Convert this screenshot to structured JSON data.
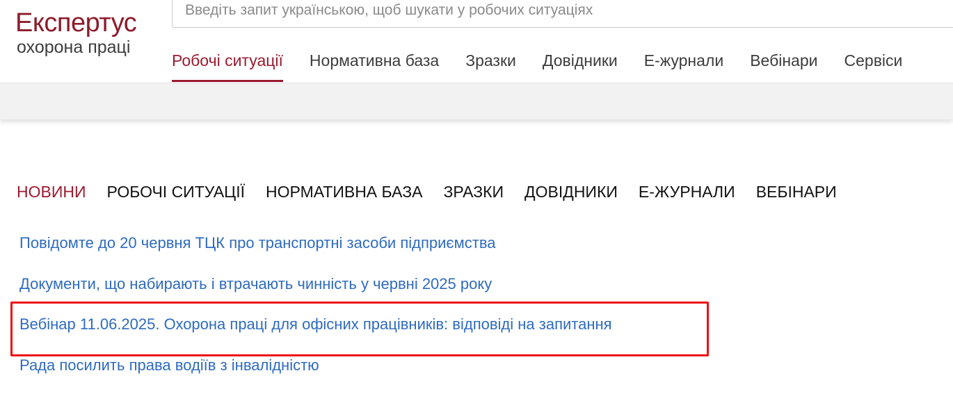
{
  "logo": {
    "brand": "Експертус",
    "subtitle": "охорона праці"
  },
  "search": {
    "placeholder": "Введіть запит українською, щоб шукати у робочих ситуаціях"
  },
  "topnav": [
    {
      "label": "Робочі ситуації",
      "active": true
    },
    {
      "label": "Нормативна база"
    },
    {
      "label": "Зразки"
    },
    {
      "label": "Довідники"
    },
    {
      "label": "Е-журнали"
    },
    {
      "label": "Вебінари"
    },
    {
      "label": "Сервіси"
    }
  ],
  "tabs": [
    {
      "label": "НОВИНИ",
      "active": true
    },
    {
      "label": "РОБОЧІ СИТУАЦІЇ"
    },
    {
      "label": "НОРМАТИВНА БАЗА"
    },
    {
      "label": "ЗРАЗКИ"
    },
    {
      "label": "ДОВІДНИКИ"
    },
    {
      "label": "Е-ЖУРНАЛИ"
    },
    {
      "label": "ВЕБІНАРИ"
    }
  ],
  "news": [
    "Повідомте до 20 червня ТЦК про транспортні засоби підприємства",
    "Документи, що набирають і втрачають чинність у червні 2025 року",
    "Вебінар 11.06.2025. Охорона праці для офісних працівників: відповіді на запитання",
    "Рада посилить права водіїв з інвалідністю"
  ],
  "colors": {
    "brand": "#9b1b30",
    "link": "#2e6bbf",
    "highlight": "#ee1111"
  }
}
